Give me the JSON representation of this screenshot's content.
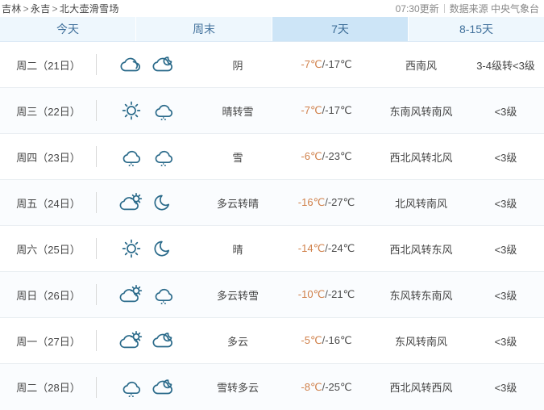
{
  "header": {
    "breadcrumb": [
      "吉林",
      "永吉",
      "北大壶滑雪场"
    ],
    "breadcrumb_separator": ">",
    "update_time": "07:30更新",
    "source": "数据来源 中央气象台"
  },
  "tabs": [
    {
      "label": "今天",
      "active": false
    },
    {
      "label": "周末",
      "active": false
    },
    {
      "label": "7天",
      "active": true
    },
    {
      "label": "8-15天",
      "active": false
    }
  ],
  "forecast": {
    "rows": [
      {
        "date": "周二（21日）",
        "icon_day": "cloudy-icon",
        "icon_night": "cloudy-night-icon",
        "desc": "阴",
        "temp_high": "-7℃",
        "temp_sep": "/",
        "temp_low": "-17℃",
        "wind": "西南风",
        "level": "3-4级转<3级"
      },
      {
        "date": "周三（22日）",
        "icon_day": "sunny-icon",
        "icon_night": "snow-icon",
        "desc": "晴转雪",
        "temp_high": "-7℃",
        "temp_sep": "/",
        "temp_low": "-17℃",
        "wind": "东南风转南风",
        "level": "<3级"
      },
      {
        "date": "周四（23日）",
        "icon_day": "snow-icon",
        "icon_night": "snow-icon",
        "desc": "雪",
        "temp_high": "-6℃",
        "temp_sep": "/",
        "temp_low": "-23℃",
        "wind": "西北风转北风",
        "level": "<3级"
      },
      {
        "date": "周五（24日）",
        "icon_day": "partly-cloudy-icon",
        "icon_night": "moon-icon",
        "desc": "多云转晴",
        "temp_high": "-16℃",
        "temp_sep": "/",
        "temp_low": "-27℃",
        "wind": "北风转南风",
        "level": "<3级"
      },
      {
        "date": "周六（25日）",
        "icon_day": "sunny-icon",
        "icon_night": "moon-icon",
        "desc": "晴",
        "temp_high": "-14℃",
        "temp_sep": "/",
        "temp_low": "-24℃",
        "wind": "西北风转东风",
        "level": "<3级"
      },
      {
        "date": "周日（26日）",
        "icon_day": "partly-cloudy-icon",
        "icon_night": "snow-icon",
        "desc": "多云转雪",
        "temp_high": "-10℃",
        "temp_sep": "/",
        "temp_low": "-21℃",
        "wind": "东风转东南风",
        "level": "<3级"
      },
      {
        "date": "周一（27日）",
        "icon_day": "partly-cloudy-icon",
        "icon_night": "cloudy-night-icon",
        "desc": "多云",
        "temp_high": "-5℃",
        "temp_sep": "/",
        "temp_low": "-16℃",
        "wind": "东风转南风",
        "level": "<3级"
      },
      {
        "date": "周二（28日）",
        "icon_day": "snow-icon",
        "icon_night": "cloudy-night-icon",
        "desc": "雪转多云",
        "temp_high": "-8℃",
        "temp_sep": "/",
        "temp_low": "-25℃",
        "wind": "西北风转西风",
        "level": "<3级"
      }
    ]
  },
  "colors": {
    "tab_active_bg": "#cde5f7",
    "tab_bg": "#eef7fd",
    "tab_text": "#41719c",
    "temp_high": "#d0804a",
    "temp_low": "#4a4a4a",
    "icon_stroke": "#2a6a8a",
    "row_alt_bg": "#fafcfe"
  }
}
